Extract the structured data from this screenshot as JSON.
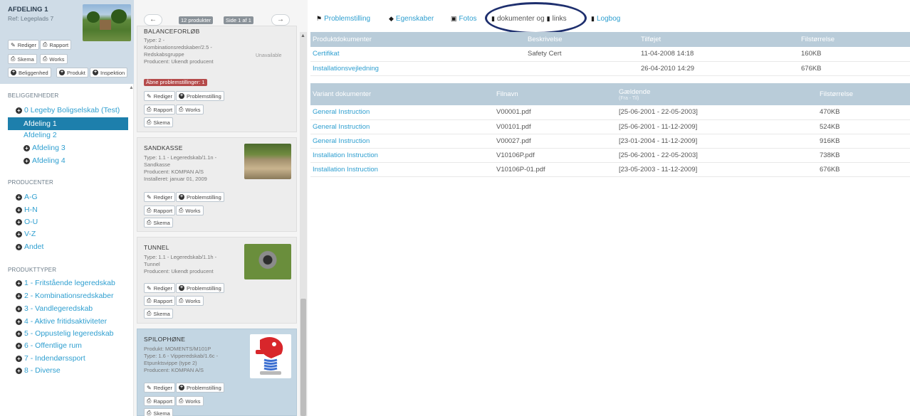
{
  "department": {
    "title": "AFDELING 1",
    "ref": "Ref: Legeplads 7",
    "buttons": {
      "edit": "Rediger",
      "report": "Rapport",
      "schema": "Skema",
      "works": "Works",
      "add_location": "Beliggenhed",
      "add_product": "Produkt",
      "add_inspection": "Inspektion"
    }
  },
  "sidebar": {
    "locations_head": "BELIGGENHEDER",
    "locations": [
      "0 Legeby Boligselskab (Test)",
      "Afdeling 1",
      "Afdeling 2",
      "Afdeling 3",
      "Afdeling 4"
    ],
    "producers_head": "PRODUCENTER",
    "producers": [
      "A-G",
      "H-N",
      "O-U",
      "V-Z",
      "Andet"
    ],
    "product_types_head": "PRODUKTTYPER",
    "product_types": [
      "1 - Fritstående legeredskab",
      "2 - Kombinationsredskaber",
      "3 - Vandlegeredskab",
      "4 - Aktive fritidsaktiviteter",
      "5 - Oppustelig legeredskab",
      "6 - Offentlige rum",
      "7 - Indendørssport",
      "8 - Diverse"
    ]
  },
  "product_list": {
    "prev": "←",
    "next": "→",
    "count": "12 produkter",
    "page": "Side 1 af 1",
    "buttons": {
      "edit": "Rediger",
      "issue": "Problemstilling",
      "report": "Rapport",
      "works": "Works",
      "schema": "Skema"
    },
    "products": [
      {
        "name": "BALANCEFORLØB",
        "info": "Type: 2 -\nKombinationsredskaber/2.5 -\nRedskabsgruppe\nProducent: Ukendt producent",
        "unavailable": "Unavailable",
        "open_issues": "Åbne problemstillinger: 1"
      },
      {
        "name": "SANDKASSE",
        "info": "Type: 1.1 - Legeredskab/1.1n -\nSandkasse\nProducent: KOMPAN A/S\nInstalleret: januar 01, 2009"
      },
      {
        "name": "TUNNEL",
        "info": "Type: 1.1 - Legeredskab/1.1h -\nTunnel\nProducent: Ukendt producent"
      },
      {
        "name": "SPILOPHØNE",
        "info": "Produkt: MOMENTS/M101P\nType: 1.6 - Vipperedskab/1.6c -\nEtpunktsvippe (type 2)\nProducent: KOMPAN A/S"
      }
    ]
  },
  "tabs": [
    {
      "icon": "flag-icon",
      "label": "Problemstilling"
    },
    {
      "icon": "tag-icon",
      "label": "Egenskaber"
    },
    {
      "icon": "photo-icon",
      "label": "Fotos"
    },
    {
      "icon": "file-icon",
      "label": "dokumenter og"
    },
    {
      "icon": "bookmark-icon",
      "label": "links"
    },
    {
      "icon": "book-icon",
      "label": "Logbog"
    }
  ],
  "product_documents": {
    "headers": [
      "Produktdokumenter",
      "Beskrivelse",
      "Tilføjet",
      "Filstørrelse"
    ],
    "rows": [
      [
        "Certifikat",
        "Safety Cert",
        "11-04-2008 14:18",
        "160KB"
      ],
      [
        "Installationsvejledning",
        "",
        "26-04-2010 14:29",
        "676KB"
      ]
    ]
  },
  "variant_documents": {
    "headers": [
      "Variant dokumenter",
      "Filnavn",
      "Gældende",
      "Filstørrelse"
    ],
    "sub_header": "(Fra - Til)",
    "rows": [
      [
        "General Instruction",
        "V00001.pdf",
        "[25-06-2001 - 22-05-2003]",
        "470KB"
      ],
      [
        "General Instruction",
        "V00101.pdf",
        "[25-06-2001 - 11-12-2009]",
        "524KB"
      ],
      [
        "General Instruction",
        "V00027.pdf",
        "[23-01-2004 - 11-12-2009]",
        "916KB"
      ],
      [
        "Installation Instruction",
        "V10106P.pdf",
        "[25-06-2001 - 22-05-2003]",
        "738KB"
      ],
      [
        "Installation Instruction",
        "V10106P-01.pdf",
        "[23-05-2003 - 11-12-2009]",
        "676KB"
      ]
    ]
  },
  "colors": {
    "accent": "#2f9fd0",
    "active_location": "#1d7fac",
    "table_header": "#b9ccd9",
    "issue_badge": "#b54b4b",
    "highlight_ring": "#1e2f6e"
  }
}
